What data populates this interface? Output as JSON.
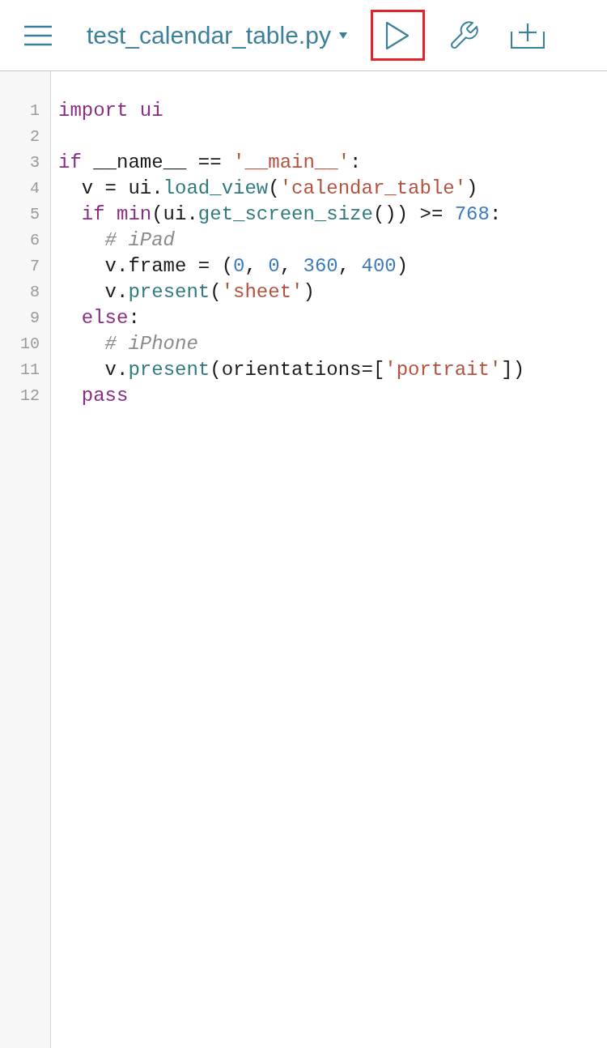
{
  "toolbar": {
    "title": "test_calendar_table.py",
    "run_highlighted": true
  },
  "lines": [
    {
      "number": "1",
      "tokens": [
        {
          "kind": "keyword",
          "text": "import ui"
        }
      ]
    },
    {
      "number": "2"
    },
    {
      "number": "3",
      "tokens": [
        {
          "kind": "keyword",
          "text": "if"
        },
        {
          "kind": "plain",
          "text": " __name__ == "
        },
        {
          "kind": "string",
          "text": "'__main__'"
        },
        {
          "kind": "plain",
          "text": ":"
        }
      ]
    },
    {
      "number": "4",
      "tokens": [
        {
          "kind": "plain",
          "text": "  v = ui."
        },
        {
          "kind": "function",
          "text": "load_view"
        },
        {
          "kind": "plain",
          "text": "("
        },
        {
          "kind": "string",
          "text": "'calendar_table'"
        },
        {
          "kind": "plain",
          "text": ")"
        }
      ]
    },
    {
      "number": "5",
      "tokens": [
        {
          "kind": "keyword",
          "text": "  if min"
        },
        {
          "kind": "plain",
          "text": "(ui."
        },
        {
          "kind": "function",
          "text": "get_screen_size"
        },
        {
          "kind": "plain",
          "text": "()) >= "
        },
        {
          "kind": "number",
          "text": "768"
        },
        {
          "kind": "plain",
          "text": ":"
        }
      ]
    },
    {
      "number": "6",
      "tokens": [
        {
          "kind": "comment",
          "text": "    # iPad"
        }
      ]
    },
    {
      "number": "7",
      "tokens": [
        {
          "kind": "plain",
          "text": "    v.frame = ("
        },
        {
          "kind": "number",
          "text": "0"
        },
        {
          "kind": "plain",
          "text": ", "
        },
        {
          "kind": "number",
          "text": "0"
        },
        {
          "kind": "plain",
          "text": ", "
        },
        {
          "kind": "number",
          "text": "360"
        },
        {
          "kind": "plain",
          "text": ", "
        },
        {
          "kind": "number",
          "text": "400"
        },
        {
          "kind": "plain",
          "text": ")"
        }
      ]
    },
    {
      "number": "8",
      "tokens": [
        {
          "kind": "plain",
          "text": "    v."
        },
        {
          "kind": "function",
          "text": "present"
        },
        {
          "kind": "plain",
          "text": "("
        },
        {
          "kind": "string",
          "text": "'sheet'"
        },
        {
          "kind": "plain",
          "text": ")"
        }
      ]
    },
    {
      "number": "9",
      "tokens": [
        {
          "kind": "keyword",
          "text": "  else"
        },
        {
          "kind": "plain",
          "text": ":"
        }
      ]
    },
    {
      "number": "10",
      "tokens": [
        {
          "kind": "comment",
          "text": "    # iPhone"
        }
      ]
    },
    {
      "number": "11",
      "tokens": [
        {
          "kind": "plain",
          "text": "    v."
        },
        {
          "kind": "function",
          "text": "present"
        },
        {
          "kind": "plain",
          "text": "(orientations=["
        },
        {
          "kind": "string",
          "text": "'portrait'"
        },
        {
          "kind": "plain",
          "text": "])"
        }
      ]
    },
    {
      "number": "12",
      "tokens": [
        {
          "kind": "keyword",
          "text": "  pass"
        }
      ]
    }
  ]
}
